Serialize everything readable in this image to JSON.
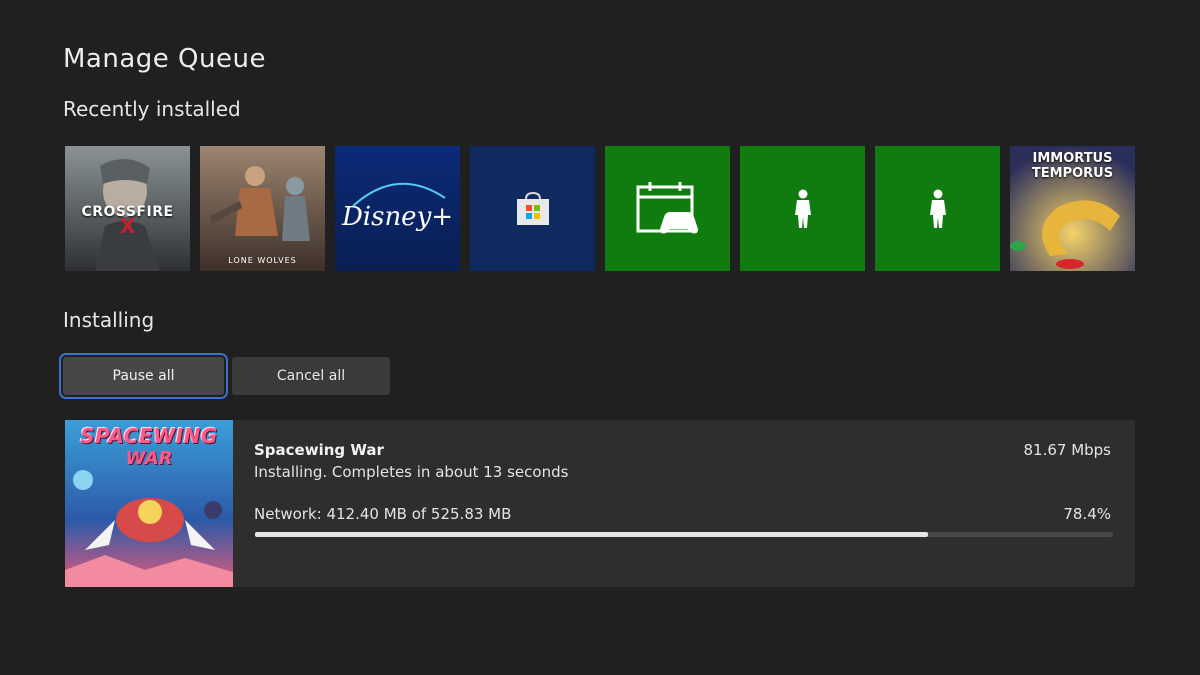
{
  "page": {
    "title": "Manage Queue"
  },
  "recently_installed": {
    "title": "Recently installed",
    "tiles": [
      {
        "name": "crossfire",
        "text": "CROSSFIRE",
        "x_mark": "X"
      },
      {
        "name": "halo-lone-wolves",
        "text": "LONE WOLVES"
      },
      {
        "name": "disney-plus",
        "text": "Disney+"
      },
      {
        "name": "microsoft-store",
        "icon": "store-bag-icon"
      },
      {
        "name": "xbox-events",
        "icon": "calendar-controller-icon"
      },
      {
        "name": "avatar-app-1",
        "icon": "avatar-figure-icon"
      },
      {
        "name": "avatar-app-2",
        "icon": "avatar-figure-icon"
      },
      {
        "name": "immortus-temporus",
        "text_line1": "IMMORTUS",
        "text_line2": "TEMPORUS"
      }
    ]
  },
  "installing": {
    "title": "Installing",
    "pause_all_label": "Pause all",
    "cancel_all_label": "Cancel all",
    "item": {
      "art_text_line1": "SPACEWING",
      "art_text_line2": "WAR",
      "name": "Spacewing War",
      "status": "Installing. Completes in about 13 seconds",
      "speed": "81.67 Mbps",
      "network": "Network: 412.40 MB of 525.83 MB",
      "percent_label": "78.4%",
      "progress": 0.784
    }
  },
  "colors": {
    "background": "#202020",
    "tile_green": "#107c10",
    "tile_blue": "#0f2a5e",
    "focus_outline": "#3d6fd1"
  }
}
